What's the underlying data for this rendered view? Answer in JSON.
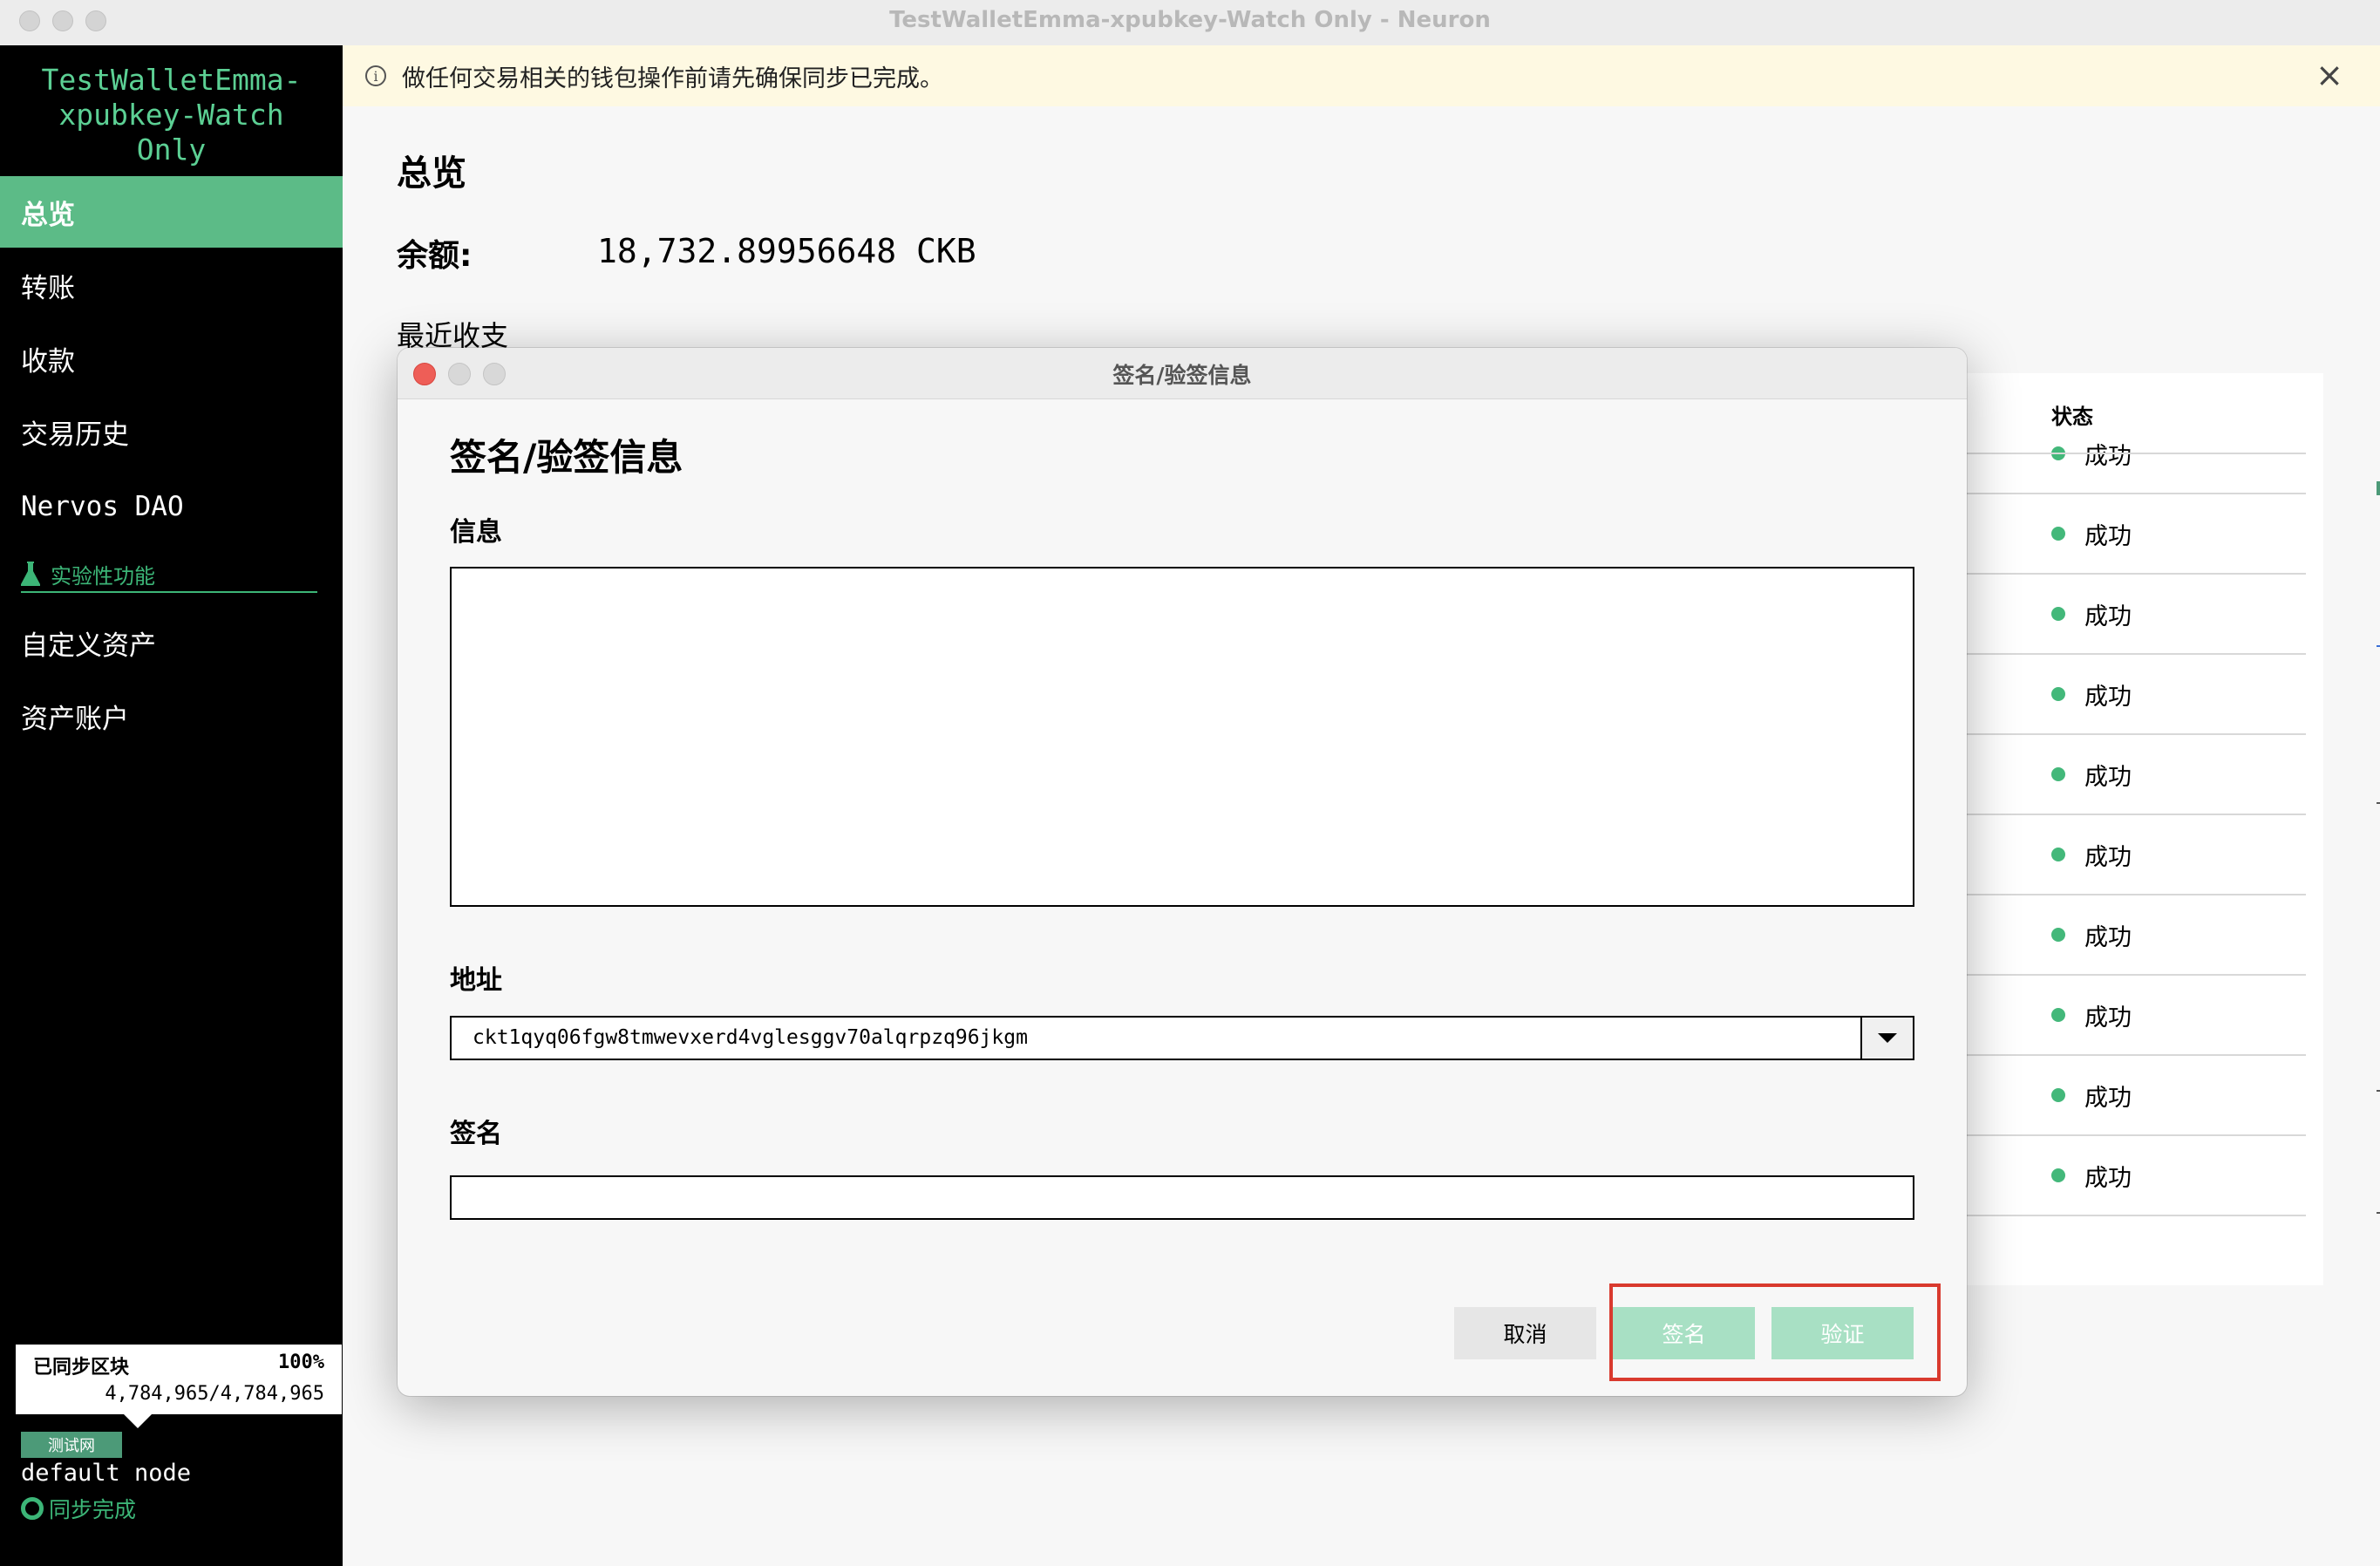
{
  "window": {
    "title": "TestWalletEmma-xpubkey-Watch Only - Neuron"
  },
  "sidebar": {
    "wallet_name": "TestWalletEmma-xpubkey-Watch Only",
    "nav": [
      {
        "label": "总览",
        "active": true
      },
      {
        "label": "转账"
      },
      {
        "label": "收款"
      },
      {
        "label": "交易历史"
      },
      {
        "label": "Nervos DAO"
      }
    ],
    "experimental_label": "实验性功能",
    "experimental_items": [
      {
        "label": "自定义资产"
      },
      {
        "label": "资产账户"
      }
    ],
    "sync": {
      "label": "已同步区块",
      "percent": "100%",
      "blocks": "4,784,965/4,784,965"
    },
    "network_badge": "测试网",
    "node_name": "default node",
    "sync_status": "同步完成"
  },
  "notice": {
    "text": "做任何交易相关的钱包操作前请先确保同步已完成。",
    "info_icon": "i",
    "close_icon": "×"
  },
  "overview": {
    "title": "总览",
    "balance_label": "余额:",
    "balance_value": "18,732.89956648 CKB",
    "recent_label": "最近收支",
    "status_header": "状态",
    "status_rows": [
      "成功",
      "成功",
      "成功",
      "成功",
      "成功",
      "成功",
      "成功",
      "成功",
      "成功",
      "成功"
    ]
  },
  "dialog": {
    "window_title": "签名/验签信息",
    "heading": "签名/验签信息",
    "message_label": "信息",
    "message_value": "",
    "address_label": "地址",
    "address_value": "ckt1qyq06fgw8tmwevxerd4vglesggv70alqrpzq96jkgm",
    "signature_label": "签名",
    "signature_value": "",
    "buttons": {
      "cancel": "取消",
      "sign": "签名",
      "verify": "验证"
    }
  },
  "colors": {
    "accent": "#5cbb87",
    "accent_text": "#3cb577",
    "disabled_button": "#a8e0c4",
    "highlight": "#d93a2e",
    "notice_bg": "#fef9e2"
  }
}
